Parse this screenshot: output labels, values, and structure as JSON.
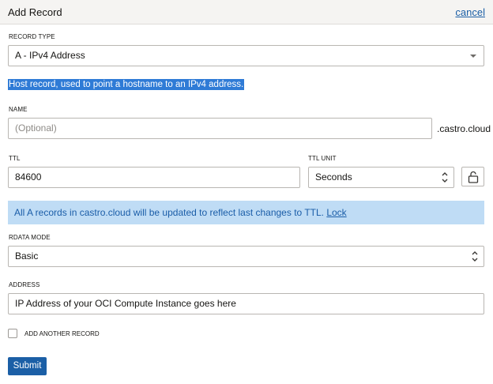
{
  "header": {
    "title": "Add Record",
    "cancel_label": "cancel"
  },
  "record_type": {
    "label": "RECORD TYPE",
    "value": "A - IPv4 Address"
  },
  "description": "Host record, used to point a hostname to an IPv4 address.",
  "name": {
    "label": "NAME",
    "placeholder": "(Optional)",
    "suffix": ".castro.cloud"
  },
  "ttl": {
    "label": "TTL",
    "value": "84600"
  },
  "ttl_unit": {
    "label": "TTL UNIT",
    "value": "Seconds"
  },
  "banner": {
    "text": "All A records in castro.cloud will be updated to reflect last changes to TTL.",
    "link": "Lock"
  },
  "rdata_mode": {
    "label": "RDATA MODE",
    "value": "Basic"
  },
  "address": {
    "label": "ADDRESS",
    "value": "IP Address of your OCI Compute Instance goes here"
  },
  "add_another": {
    "label": "ADD ANOTHER RECORD",
    "checked": false
  },
  "submit_label": "Submit",
  "colors": {
    "primary": "#1b5fa6",
    "banner_bg": "#bfdcf5",
    "highlight": "#2f7bd6"
  }
}
